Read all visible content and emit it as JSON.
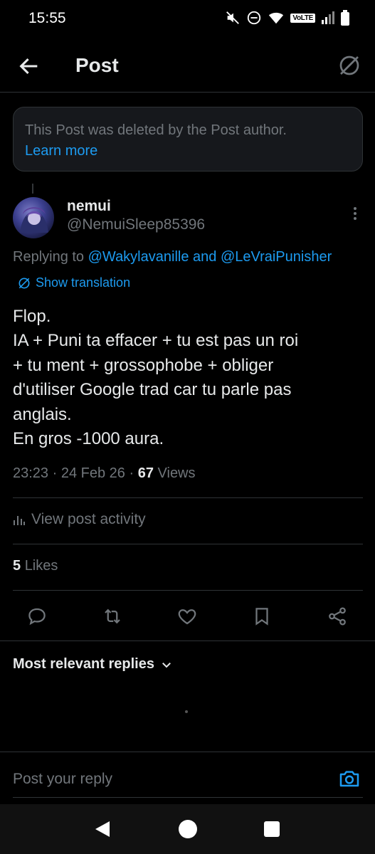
{
  "status_bar": {
    "time": "15:55",
    "volte": "VoLTE",
    "icons": [
      "mute-icon",
      "dnd-icon",
      "wifi-icon",
      "volte-badge",
      "signal-icon",
      "battery-icon"
    ]
  },
  "header": {
    "title": "Post",
    "back_icon": "arrow-left-icon",
    "translate_icon": "translate-slash-icon"
  },
  "deleted_notice": {
    "text": "This Post was deleted by the Post author.",
    "link": "Learn more"
  },
  "post": {
    "author_name": "nemui",
    "author_handle": "@NemuiSleep85396",
    "replying_prefix": "Replying to ",
    "replying_mention_1": "@Wakylavanille",
    "replying_and": " and ",
    "replying_mention_2": "@LeVraiPunisher",
    "show_translation": "Show translation",
    "body_lines": [
      "Flop.",
      "IA + Puni ta effacer + tu est pas un roi",
      "+ tu ment + grossophobe + obliger",
      "d'utiliser Google trad car tu parle pas",
      "anglais.",
      "En gros -1000 aura."
    ],
    "time": "23:23",
    "date": "24 Feb 26",
    "views_count": "67",
    "views_label": "Views",
    "separator": " · ",
    "view_activity": "View post activity",
    "likes_count": "5",
    "likes_label": "Likes"
  },
  "actions": [
    "reply-icon",
    "repost-icon",
    "like-icon",
    "bookmark-icon",
    "share-icon"
  ],
  "replies": {
    "sort_label": "Most relevant replies"
  },
  "composer": {
    "placeholder": "Post your reply"
  },
  "colors": {
    "background": "#000000",
    "text": "#e7e9ea",
    "muted": "#71767b",
    "accent": "#1d9bf0",
    "divider": "#2f3336"
  }
}
